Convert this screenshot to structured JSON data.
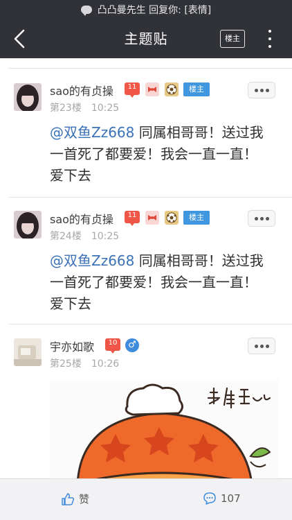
{
  "status_bar": {
    "notification": "凸凸曼先生 回复你: [表情]"
  },
  "nav": {
    "title": "主题贴",
    "louzhu_label": "楼主"
  },
  "posts": [
    {
      "username": "sao的有贞操",
      "level": "11",
      "owner_tag": "楼主",
      "floor": "第23楼",
      "time": "10:25",
      "mention": "@双鱼Zz668",
      "line1_rest": " 同属相哥哥！送过我",
      "line2": "一首死了都要爱！我会一直一直！",
      "line3": "爱下去"
    },
    {
      "username": "sao的有贞操",
      "level": "11",
      "owner_tag": "楼主",
      "floor": "第24楼",
      "time": "10:25",
      "mention": "@双鱼Zz668",
      "line1_rest": " 同属相哥哥！送过我",
      "line2": "一首死了都要爱！我会一直一直！",
      "line3": "爱下去"
    },
    {
      "username": "宇亦如歌",
      "level": "10",
      "gender": "♂",
      "floor": "第25楼",
      "time": "10:26"
    }
  ],
  "footer": {
    "like_label": "赞",
    "comment_count": "107"
  },
  "colors": {
    "nav_bg": "#303238",
    "accent_blue": "#3f97df",
    "level_red": "#ef5647",
    "mention_blue": "#3b71b7"
  }
}
